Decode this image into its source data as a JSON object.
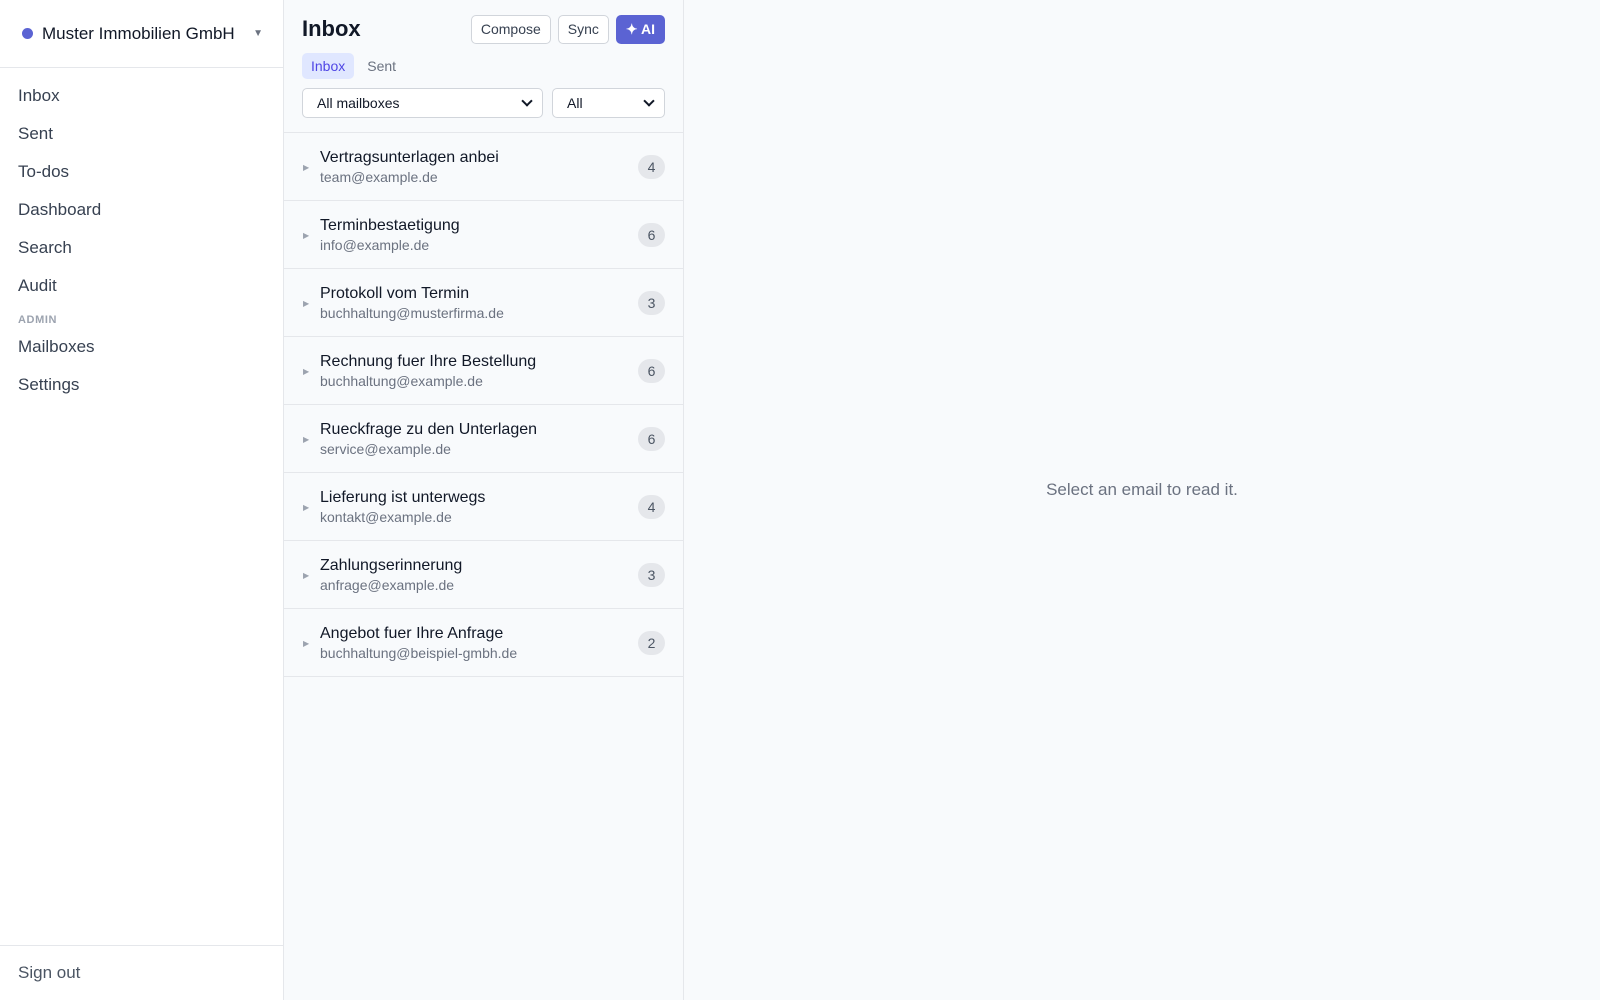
{
  "org": {
    "name": "Muster Immobilien GmbH",
    "dot_color": "#5b63d3",
    "caret_icon": "chevron-down-icon"
  },
  "nav": {
    "items": [
      {
        "label": "Inbox"
      },
      {
        "label": "Sent"
      },
      {
        "label": "To-dos"
      },
      {
        "label": "Dashboard"
      },
      {
        "label": "Search"
      },
      {
        "label": "Audit"
      }
    ],
    "admin_label": "ADMIN",
    "admin_items": [
      {
        "label": "Mailboxes"
      },
      {
        "label": "Settings"
      }
    ],
    "sign_out": "Sign out"
  },
  "list": {
    "title": "Inbox",
    "compose_label": "Compose",
    "sync_label": "Sync",
    "ai_label": "✦ AI",
    "tabs": [
      {
        "label": "Inbox",
        "active": true
      },
      {
        "label": "Sent",
        "active": false
      }
    ],
    "mailbox_filter": "All mailboxes",
    "status_filter": "All",
    "threads": [
      {
        "subject": "Vertragsunterlagen anbei",
        "from": "team@example.de",
        "count": "4"
      },
      {
        "subject": "Terminbestaetigung",
        "from": "info@example.de",
        "count": "6"
      },
      {
        "subject": "Protokoll vom Termin",
        "from": "buchhaltung@musterfirma.de",
        "count": "3"
      },
      {
        "subject": "Rechnung fuer Ihre Bestellung",
        "from": "buchhaltung@example.de",
        "count": "6"
      },
      {
        "subject": "Rueckfrage zu den Unterlagen",
        "from": "service@example.de",
        "count": "6"
      },
      {
        "subject": "Lieferung ist unterwegs",
        "from": "kontakt@example.de",
        "count": "4"
      },
      {
        "subject": "Zahlungserinnerung",
        "from": "anfrage@example.de",
        "count": "3"
      },
      {
        "subject": "Angebot fuer Ihre Anfrage",
        "from": "buchhaltung@beispiel-gmbh.de",
        "count": "2"
      }
    ]
  },
  "reader": {
    "empty_message": "Select an email to read it."
  },
  "colors": {
    "accent": "#5b63d3",
    "tab_active_bg": "#e0e7ff",
    "tab_active_text": "#4f46e5"
  }
}
